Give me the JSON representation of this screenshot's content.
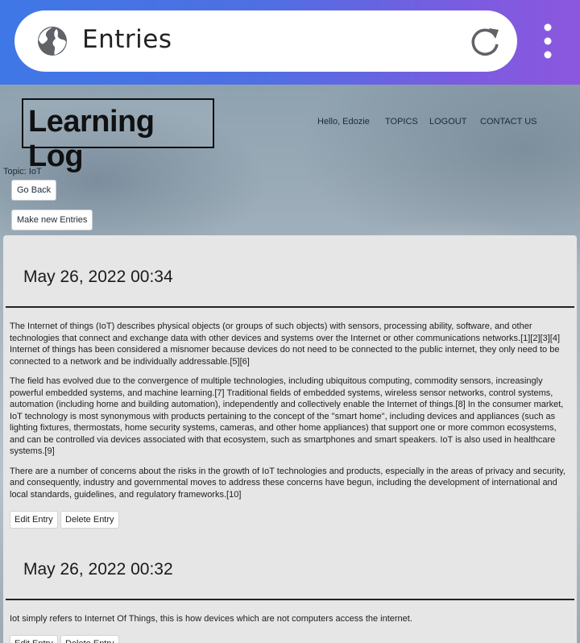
{
  "browser": {
    "title": "Entries",
    "icons": {
      "site": "globe-icon",
      "reload": "reload-icon",
      "menu": "kebab-menu-icon"
    }
  },
  "header": {
    "logo": "Learning Log",
    "greeting": "Hello, Edozie",
    "nav": {
      "topics": "TOPICS",
      "logout": "LOGOUT",
      "contact": "CONTACT US"
    }
  },
  "topic": {
    "label": "Topic: IoT",
    "go_back": "Go Back",
    "new_entry": "Make new Entries"
  },
  "entries": [
    {
      "date": "May 26, 2022 00:34",
      "paragraphs": [
        "The Internet of things (IoT) describes physical objects (or groups of such objects) with sensors, processing ability, software, and other technologies that connect and exchange data with other devices and systems over the Internet or other communications networks.[1][2][3][4] Internet of things has been considered a misnomer because devices do not need to be connected to the public internet, they only need to be connected to a network and be individually addressable.[5][6]",
        "The field has evolved due to the convergence of multiple technologies, including ubiquitous computing, commodity sensors, increasingly powerful embedded systems, and machine learning.[7] Traditional fields of embedded systems, wireless sensor networks, control systems, automation (including home and building automation), independently and collectively enable the Internet of things.[8] In the consumer market, IoT technology is most synonymous with products pertaining to the concept of the \"smart home\", including devices and appliances (such as lighting fixtures, thermostats, home security systems, cameras, and other home appliances) that support one or more common ecosystems, and can be controlled via devices associated with that ecosystem, such as smartphones and smart speakers. IoT is also used in healthcare systems.[9]",
        "There are a number of concerns about the risks in the growth of IoT technologies and products, especially in the areas of privacy and security, and consequently, industry and governmental moves to address these concerns have begun, including the development of international and local standards, guidelines, and regulatory frameworks.[10]"
      ],
      "edit": "Edit Entry",
      "delete": "Delete Entry"
    },
    {
      "date": "May 26, 2022 00:32",
      "paragraphs": [
        "Iot simply refers to Internet Of Things, this is how devices which are not computers access the internet."
      ],
      "edit": "Edit Entry",
      "delete": "Delete Entry"
    }
  ]
}
